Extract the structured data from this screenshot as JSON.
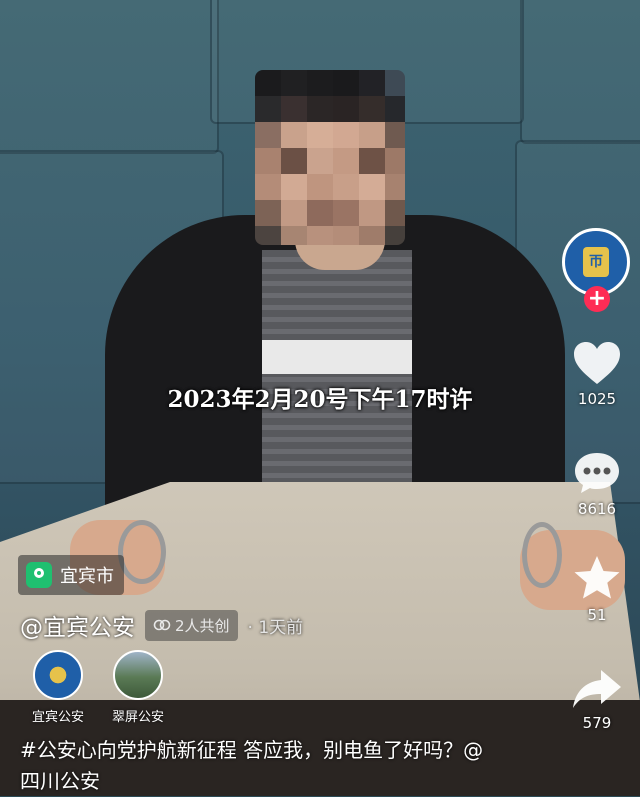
{
  "overlay_caption": "2023年2月20号下午17时许",
  "account": {
    "avatar_badge": "帀",
    "follow_label": "+"
  },
  "actions": {
    "like_count": "1025",
    "comment_count": "8616",
    "favorite_count": "51",
    "share_count": "579"
  },
  "location": {
    "label": "宜宾市"
  },
  "post": {
    "author": "@宜宾公安",
    "cocreate_label": "2人共创",
    "time": "· 1天前",
    "description": "#公安心向党护航新征程 答应我，别电鱼了好吗？@四川公安"
  },
  "coauthors": [
    {
      "name": "宜宾公安"
    },
    {
      "name": "翠屏公安"
    }
  ],
  "colors": {
    "follow": "#fe2c55",
    "location_pin": "#1fc070"
  }
}
